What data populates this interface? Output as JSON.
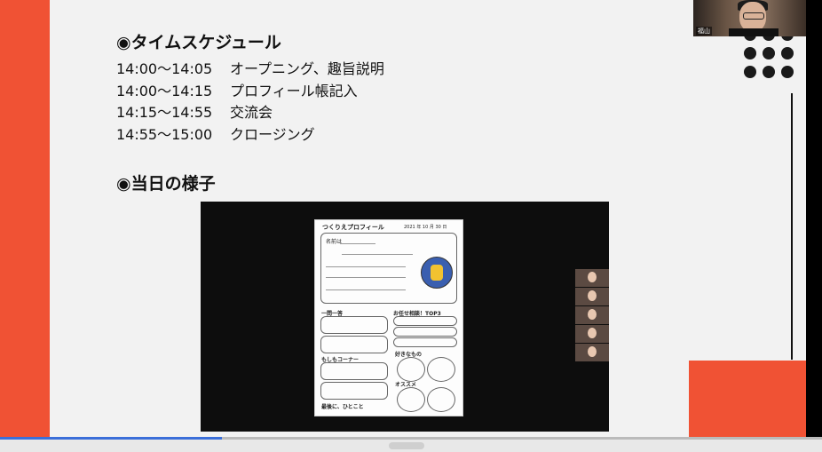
{
  "slide": {
    "schedule_heading": "◉タイムスケジュール",
    "schedule": [
      {
        "time": "14:00〜14:05",
        "item": "オープニング、趣旨説明"
      },
      {
        "time": "14:00〜14:15",
        "item": "プロフィール帳記入"
      },
      {
        "time": "14:15〜14:55",
        "item": "交流会"
      },
      {
        "time": "14:55〜15:00",
        "item": "クロージング"
      }
    ],
    "day_heading": "◉当日の様子"
  },
  "profile_sheet": {
    "title": "つくりえプロフィール",
    "date": "2021 年 10 月 30 日",
    "intro": "名前は",
    "section_ichimon": "一問一答",
    "section_moshimo": "もしもコーナー",
    "section_saigo": "最後に、ひとこと",
    "section_omakase": "お任せ相談！TOP3",
    "section_suki": "好きなもの",
    "section_osusume": "オススメ"
  },
  "camera": {
    "name_label": "福山"
  },
  "colors": {
    "accent": "#f05234",
    "dark": "#111111",
    "progress": "#3b6fd9"
  },
  "progress": {
    "fraction": 0.27
  }
}
